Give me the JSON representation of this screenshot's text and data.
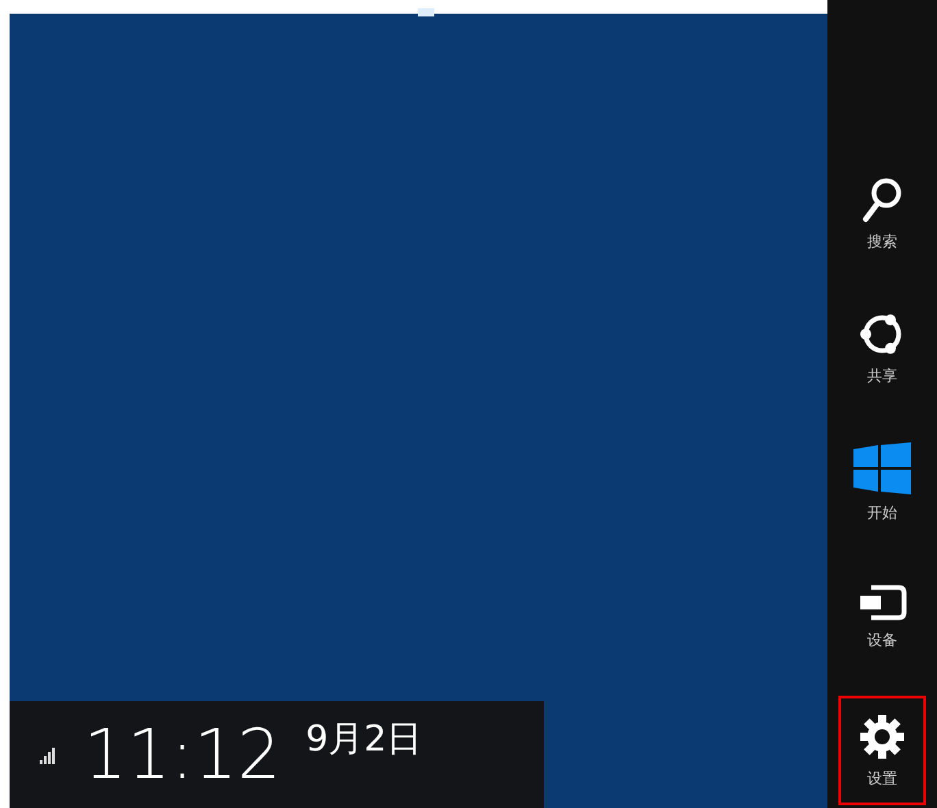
{
  "charms": [
    {
      "kind": "search",
      "label": "搜索",
      "selected": false
    },
    {
      "kind": "share",
      "label": "共享",
      "selected": false
    },
    {
      "kind": "start",
      "label": "开始",
      "selected": false
    },
    {
      "kind": "devices",
      "label": "设备",
      "selected": false
    },
    {
      "kind": "settings",
      "label": "设置",
      "selected": true
    }
  ],
  "clock": {
    "time": "11:12",
    "date": "9月2日"
  }
}
